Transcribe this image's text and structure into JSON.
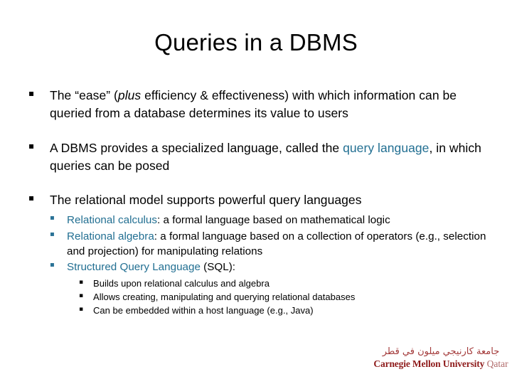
{
  "slide": {
    "title": "Queries in a DBMS",
    "background_color": "#FFFFFF",
    "accent_color": "#226F92",
    "text_color": "#000000"
  },
  "bullets": {
    "b1": {
      "marker": "square-bullet",
      "part1": "The “ease” (",
      "italic": "plus",
      "part2": " efficiency & effectiveness) with which information can be queried from a database determines its value to users"
    },
    "b2": {
      "marker": "square-bullet",
      "part1": "A DBMS provides a specialized language, called the ",
      "accent": "query language",
      "part2": ", in which queries can be posed"
    },
    "b3": {
      "marker": "square-bullet",
      "text": "The relational model supports powerful query languages"
    },
    "b3_sub": [
      {
        "marker": "square-bullet",
        "accent": "Relational calculus",
        "rest": ": a formal language based on mathematical logic"
      },
      {
        "marker": "square-bullet",
        "accent": "Relational algebra",
        "rest": ": a formal language based on a collection of operators (e.g., selection and projection) for manipulating relations"
      },
      {
        "marker": "square-bullet",
        "accent": "Structured Query Language",
        "rest": " (SQL):"
      }
    ],
    "b3_sub3_sub": [
      {
        "marker": "square-bullet",
        "text": "Builds upon relational calculus and algebra"
      },
      {
        "marker": "square-bullet",
        "text": "Allows creating, manipulating and querying relational databases"
      },
      {
        "marker": "square-bullet",
        "text": "Can be embedded within a host language (e.g., Java)"
      }
    ]
  },
  "logo": {
    "arabic": "جامعة كارنيجي ميلون في قطر",
    "english_main": "Carnegie Mellon University",
    "english_sub": "Qatar",
    "color": "#8E1B1B"
  }
}
